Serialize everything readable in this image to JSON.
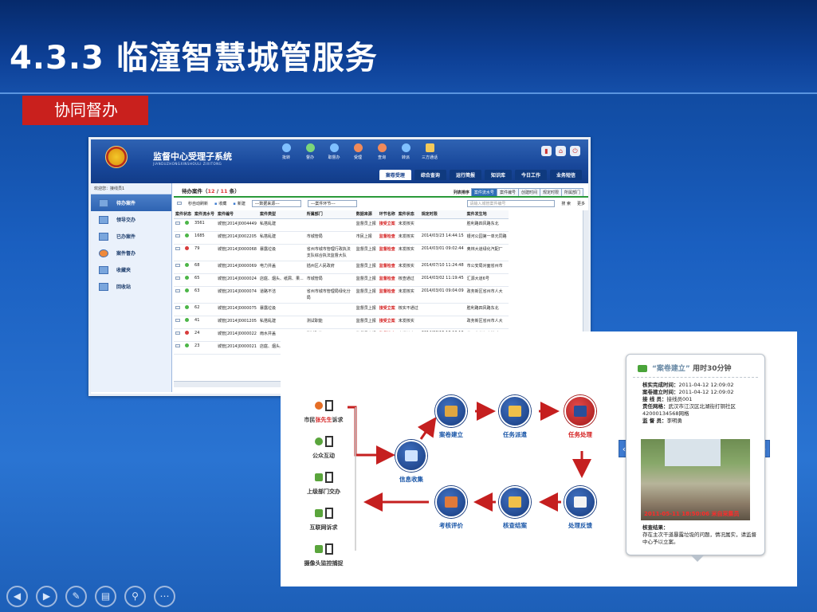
{
  "slide": {
    "title": "4.3.3 临潼智慧城管服务",
    "section": "协同督办"
  },
  "app": {
    "title": "监督中心受理子系统",
    "subtitle": "JIANDUZHONGXINSHOULI ZIXITONG",
    "tools": [
      "批转",
      "督办",
      "取督办",
      "受理",
      "查询",
      "转派",
      "三方通话"
    ],
    "nav_tabs": [
      "案卷受理",
      "综合查询",
      "运行简报",
      "知识库",
      "今日工作",
      "业务短信"
    ],
    "welcome": "欢迎您：接线员1",
    "side_items": [
      "待办案件",
      "领导交办",
      "已办案件",
      "案件督办",
      "收藏夹",
      "回收站"
    ],
    "page_title_prefix": "待办案件（",
    "count_current": "12",
    "count_sep": " / ",
    "count_total": "11",
    "count_suffix": " 条）",
    "sort_label": "列表排序",
    "sorts": [
      "案件流水号",
      "案件编号",
      "创建时间",
      "规定时限",
      "所属部门"
    ],
    "toolbar": {
      "refresh": "秒自动刷新",
      "collect": "收藏",
      "new": "新建"
    },
    "select_source": "---数据来源---",
    "select_stage": "---案件环节---",
    "search_placeholder": "请输入城管案件编号",
    "search_button": "搜 索",
    "more_button": "更多",
    "columns": [
      "案件状态",
      "案件流水号",
      "案件编号",
      "案件类型",
      "所属部门",
      "数据来源",
      "环节名称",
      "案件状态",
      "规定时限",
      "案件发生地"
    ],
    "rows": [
      {
        "seq": "3561",
        "code": "城管[2014]0004449",
        "type": "私搭乱建",
        "dept": "",
        "src": "监督员上报",
        "stage": "接受立案",
        "status": "未发核实",
        "time": "",
        "place": "胜利路四风路东北",
        "light": "#4cb648"
      },
      {
        "seq": "1685",
        "code": "城管[2014]0002205",
        "type": "私搭乱建",
        "dept": "市城管局",
        "src": "市民上报",
        "stage": "监督检查",
        "status": "未发核实",
        "time": "2014/03/23 14:44:15",
        "place": "银河公园第一单元同路",
        "light": "#4cb648"
      },
      {
        "seq": "79",
        "code": "城管[2014]0000068",
        "type": "暴露垃圾",
        "dept": "省州市城市管理行政执法支队综合执法监督大队",
        "src": "监督员上报",
        "stage": "监督检查",
        "status": "未发核实",
        "time": "2014/03/01 09:02:44",
        "place": "奥林大道绿化汽配厂",
        "light": "#d83b3b"
      },
      {
        "seq": "68",
        "code": "城管[2014]0000069",
        "type": "电力井盖",
        "dept": "插州区人民政府",
        "src": "监督员上报",
        "stage": "监督检查",
        "status": "未发核实",
        "time": "2014/07/10 11:24:48",
        "place": "市公安局对面省州市",
        "light": "#4cb648"
      },
      {
        "seq": "65",
        "code": "城管[2014]0000024",
        "type": "店庭、烟头、纸屑、果...",
        "dept": "市城管局",
        "src": "监督员上报",
        "stage": "监督检查",
        "status": "核查通过",
        "time": "2014/03/02 11:19:45",
        "place": "汇源大道6号",
        "light": "#4cb648"
      },
      {
        "seq": "63",
        "code": "城管[2014]0000074",
        "type": "道路不洁",
        "dept": "省州市城市管理局绿化分局",
        "src": "监督员上报",
        "stage": "监督检查",
        "status": "未发核实",
        "time": "2014/03/01 09:04:09",
        "place": "政务新区省州市人大",
        "light": "#4cb648"
      },
      {
        "seq": "62",
        "code": "城管[2014]0000075",
        "type": "暴露垃圾",
        "dept": "",
        "src": "监督员上报",
        "stage": "接受立案",
        "status": "核实不通过",
        "time": "",
        "place": "胜利路四风路东北",
        "light": "#4cb648"
      },
      {
        "seq": "41",
        "code": "城管[2014]0001205",
        "type": "私搭乱建",
        "dept": "测试职能",
        "src": "监督员上报",
        "stage": "接受立案",
        "status": "未发核实",
        "time": "",
        "place": "政务新区省州市人大",
        "light": "#4cb648"
      },
      {
        "seq": "24",
        "code": "城管[2014]0000022",
        "type": "雨水井盖",
        "dept": "测试职能",
        "src": "监督员上报",
        "stage": "监督检查",
        "status": "未发核实",
        "time": "2014/03/15 18:13:10",
        "place": "省州市老年大学 东",
        "light": "#d83b3b"
      },
      {
        "seq": "23",
        "code": "城管[2014]0000021",
        "type": "店庭、烟头、纸屑、果...",
        "dept": "市城管局",
        "src": "监督员上报",
        "stage": "监督检查",
        "status": "核查通过",
        "time": "2014/02/23 17:09:54",
        "place": "政务新区省州市人大",
        "light": "#4cb648"
      }
    ]
  },
  "flow": {
    "channels": [
      {
        "prefix": "市民",
        "highlight": "张先生",
        "suffix": "诉求"
      },
      {
        "prefix": "公众互动",
        "highlight": "",
        "suffix": ""
      },
      {
        "prefix": "上级部门交办",
        "highlight": "",
        "suffix": ""
      },
      {
        "prefix": "互联网诉求",
        "highlight": "",
        "suffix": ""
      },
      {
        "prefix": "摄像头监控捕捉",
        "highlight": "",
        "suffix": ""
      }
    ],
    "nodes": {
      "collect": "信息收集",
      "create": "案卷建立",
      "dispatch": "任务派遣",
      "handle": "任务处理",
      "feedback": "处理反馈",
      "close": "核查结案",
      "evaluate": "考核评价"
    }
  },
  "card": {
    "heading_quote": "“案卷建立”",
    "heading_time": "用时30分钟",
    "lines": [
      {
        "label": "核实完成时间：",
        "value": "2011-04-12 12:09:02"
      },
      {
        "label": "案卷建立时间：",
        "value": "2011-04-12 12:09:02"
      },
      {
        "label": "接 线 员：",
        "value": "接线员001"
      },
      {
        "label": "责任网格：",
        "value": "武汉市江汉区北湖街打铜社区42000134568网格"
      },
      {
        "label": "监 督 员：",
        "value": "李明勇"
      }
    ],
    "photo_stamp": "2011-05-11 18:50:06 米自采集员",
    "result_label": "核查结果：",
    "result_text": "存在主次干道暴露垃圾的问题，情况属实，请监督中心予以立案。",
    "prev": "‹",
    "next": "›"
  },
  "controls": [
    "◀",
    "▶",
    "✎",
    "▤",
    "⚲",
    "⋯"
  ]
}
